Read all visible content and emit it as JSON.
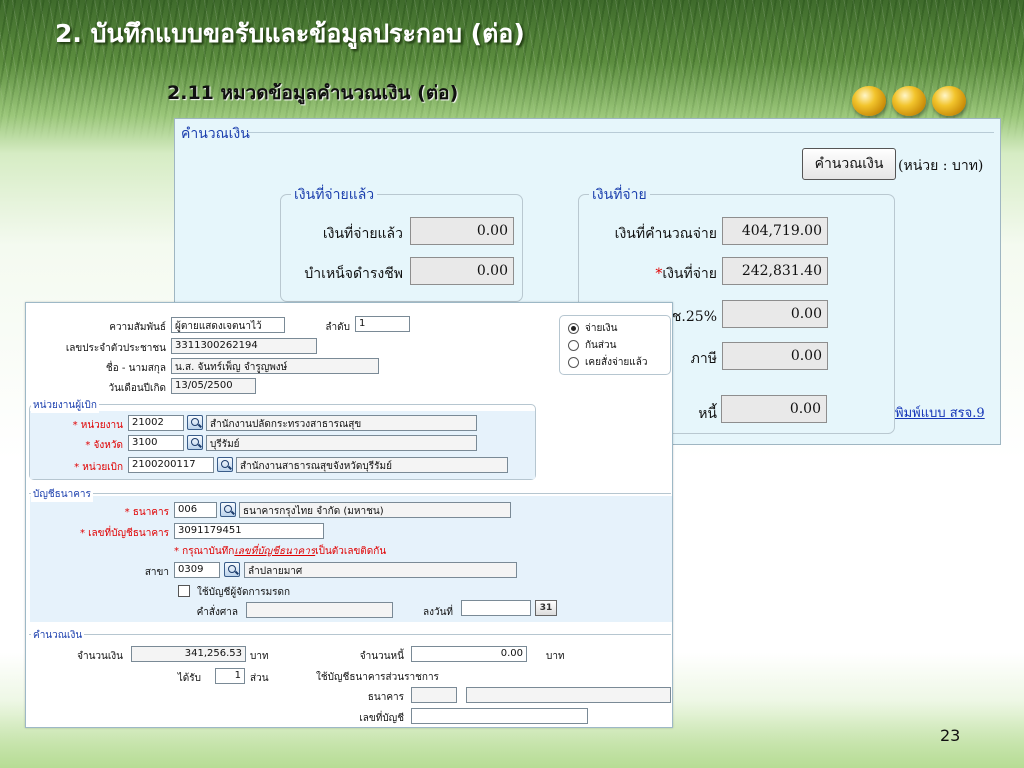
{
  "slide": {
    "title": "2. บันทึกแบบขอรับและข้อมูลประกอบ (ต่อ)",
    "subtitle": "2.11 หมวดข้อมูลคำนวณเงิน (ต่อ)",
    "page_number": "23",
    "colors": {
      "accent_green": "#5c8d3f",
      "heading_blue": "#1b3fae",
      "required_red": "#e00000"
    }
  },
  "calc_window": {
    "title": "คำนวณเงิน",
    "calc_button": "คำนวณเงิน",
    "unit": "(หน่วย : บาท)",
    "paid_group": {
      "legend": "เงินที่จ่ายแล้ว",
      "paid_label": "เงินที่จ่ายแล้ว",
      "paid_value": "0.00",
      "pension_label": "บำเหน็จดำรงชีพ",
      "pension_value": "0.00"
    },
    "payable_group": {
      "legend": "เงินที่จ่าย",
      "computed_label": "เงินที่คำนวณจ่าย",
      "computed_value": "404,719.00",
      "pay_label": "เงินที่จ่าย",
      "pay_value": "242,831.40",
      "fund_label": "ช.25%",
      "fund_value": "0.00",
      "tax_label": "ภาษี",
      "tax_value": "0.00",
      "debt_label": "หนี้",
      "debt_value": "0.00"
    },
    "print_link": "พิมพ์แบบ สรจ.9"
  },
  "form_window": {
    "relation_label": "ความสัมพันธ์",
    "relation_value": "ผู้ตายแสดงเจตนาไว้",
    "order_label": "ลำดับ",
    "order_value": "1",
    "citizen_id_label": "เลขประจำตัวประชาชน",
    "citizen_id_value": "3311300262194",
    "name_label": "ชื่อ - นามสกุล",
    "name_value": "น.ส. จันทร์เพ็ญ จำรูญพงษ์",
    "dob_label": "วันเดือนปีเกิด",
    "dob_value": "13/05/2500",
    "payment_options": [
      {
        "label": "จ่ายเงิน",
        "selected": true
      },
      {
        "label": "กันส่วน",
        "selected": false
      },
      {
        "label": "เคยสั่งจ่ายแล้ว",
        "selected": false
      }
    ],
    "agency_section": {
      "legend": "หน่วยงานผู้เบิก",
      "agency_label": "* หน่วยงาน",
      "agency_code": "21002",
      "agency_name": "สำนักงานปลัดกระทรวงสาธารณสุข",
      "province_label": "* จังหวัด",
      "province_code": "3100",
      "province_name": "บุรีรัมย์",
      "unit_label": "* หน่วยเบิก",
      "unit_code": "2100200117",
      "unit_name": "สำนักงานสาธารณสุขจังหวัดบุรีรัมย์"
    },
    "bank_section": {
      "legend": "บัญชีธนาคาร",
      "bank_label": "* ธนาคาร",
      "bank_code": "006",
      "bank_name": "ธนาคารกรุงไทย จำกัด (มหาชน)",
      "account_label": "* เลขที่บัญชีธนาคาร",
      "account_value": "3091179451",
      "warning_prefix": "* กรุณาบันทึก",
      "warning_link": "เลขที่บัญชีธนาคาร",
      "warning_suffix": "เป็นตัวเลขติดกัน",
      "branch_label": "สาขา",
      "branch_code": "0309",
      "branch_name": "ลำปลายมาศ",
      "estate_checkbox_label": "ใช้บัญชีผู้จัดการมรดก",
      "court_order_label": "คำสั่งศาล",
      "court_order_value": "",
      "dated_label": "ลงวันที่",
      "dated_value": "",
      "calendar_icon_text": "31"
    },
    "money_section": {
      "legend": "คำนวณเงิน",
      "amount_label": "จำนวนเงิน",
      "amount_value": "341,256.53",
      "amount_unit": "บาท",
      "share_label": "ได้รับ",
      "share_value": "1",
      "share_unit": "ส่วน",
      "debt_label": "จำนวนหนี้",
      "debt_value": "0.00",
      "debt_unit": "บาท",
      "gov_account_label": "ใช้บัญชีธนาคารส่วนราชการ",
      "gov_bank_label": "ธนาคาร",
      "gov_bank_code": "",
      "gov_bank_name": "",
      "gov_account_no_label": "เลขที่บัญชี",
      "gov_account_no_value": ""
    }
  }
}
